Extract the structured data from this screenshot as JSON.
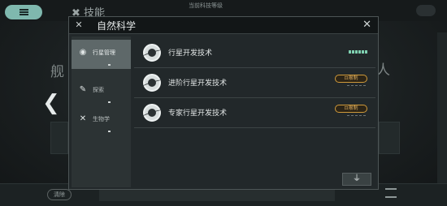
{
  "background": {
    "tech_title": "✖ 技能",
    "current_level": "当前科技等级",
    "left_partial": "舰",
    "right_partial": "人",
    "nav_arrow": "❮",
    "bottom_badge": "清除"
  },
  "modal": {
    "title": "自然科学",
    "close_label": "✕",
    "sidebar": {
      "items": [
        {
          "label": "行星管理",
          "icon": "planet-icon",
          "active": true
        },
        {
          "label": "探索",
          "icon": "explore-icon",
          "active": false
        },
        {
          "label": "生物学",
          "icon": "dna-icon",
          "active": false
        }
      ]
    },
    "techs": [
      {
        "name": "行星开发技术",
        "status": "researched"
      },
      {
        "name": "进阶行星开发技术",
        "badge": "⊡限制"
      },
      {
        "name": "专家行星开发技术",
        "badge": "⊡限制"
      }
    ],
    "filter_label": "⏚"
  },
  "colors": {
    "accent": "#7fb8ae",
    "limit_badge": "#d09a3a",
    "progress": "#7fd0b0"
  }
}
